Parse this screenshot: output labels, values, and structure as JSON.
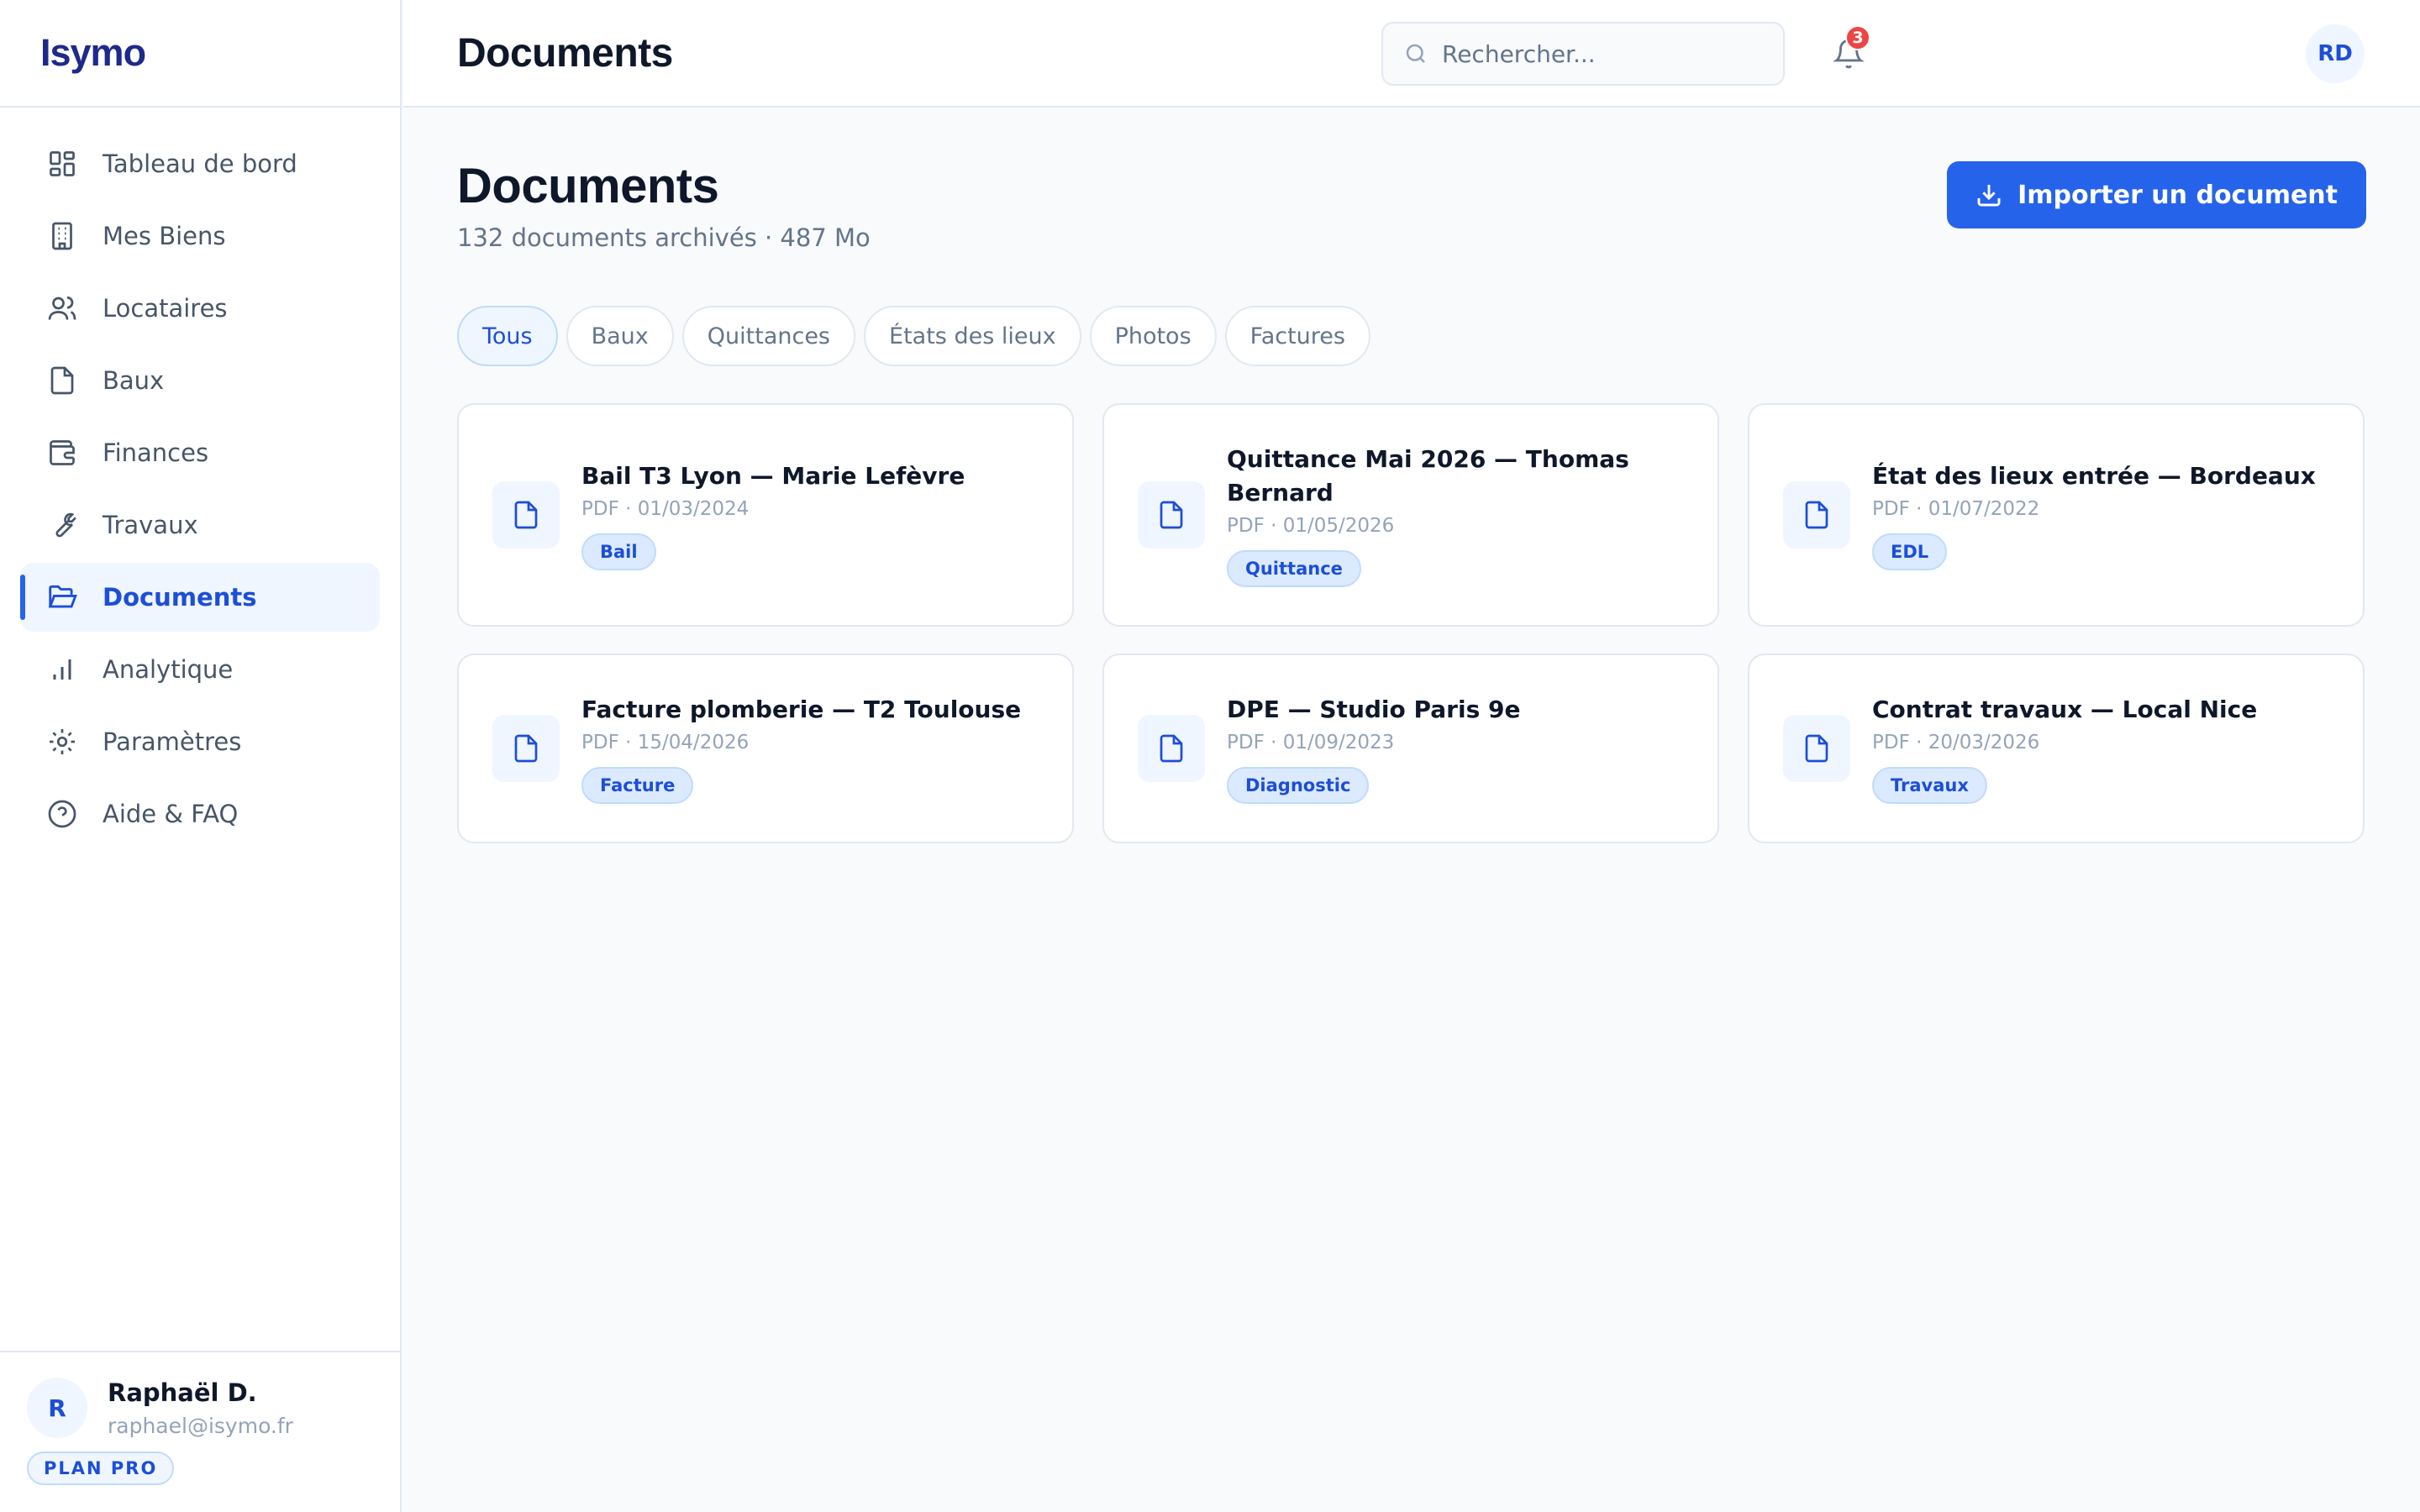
{
  "brand": {
    "name": "Isymo"
  },
  "sidebar": {
    "items": [
      {
        "label": "Tableau de bord",
        "icon": "dashboard-icon"
      },
      {
        "label": "Mes Biens",
        "icon": "building-icon"
      },
      {
        "label": "Locataires",
        "icon": "users-icon"
      },
      {
        "label": "Baux",
        "icon": "file-icon"
      },
      {
        "label": "Finances",
        "icon": "wallet-icon"
      },
      {
        "label": "Travaux",
        "icon": "wrench-icon"
      },
      {
        "label": "Documents",
        "icon": "folder-open-icon",
        "active": true
      },
      {
        "label": "Analytique",
        "icon": "bar-chart-icon"
      },
      {
        "label": "Paramètres",
        "icon": "gear-icon"
      },
      {
        "label": "Aide & FAQ",
        "icon": "help-circle-icon"
      }
    ]
  },
  "user": {
    "initial": "R",
    "name": "Raphaël D.",
    "email": "raphael@isymo.fr",
    "plan": "PLAN PRO"
  },
  "header": {
    "title": "Documents",
    "search_placeholder": "Rechercher...",
    "notifications_count": "3",
    "avatar_initials": "RD"
  },
  "page": {
    "title": "Documents",
    "subtitle": "132 documents archivés · 487 Mo",
    "import_label": "Importer un document"
  },
  "tabs": [
    {
      "label": "Tous",
      "active": true
    },
    {
      "label": "Baux"
    },
    {
      "label": "Quittances"
    },
    {
      "label": "États des lieux"
    },
    {
      "label": "Photos"
    },
    {
      "label": "Factures"
    }
  ],
  "documents": [
    {
      "title": "Bail T3 Lyon — Marie Lefèvre",
      "meta": "PDF · 01/03/2024",
      "tag": "Bail"
    },
    {
      "title": "Quittance Mai 2026 — Thomas Bernard",
      "meta": "PDF · 01/05/2026",
      "tag": "Quittance"
    },
    {
      "title": "État des lieux entrée — Bordeaux",
      "meta": "PDF · 01/07/2022",
      "tag": "EDL"
    },
    {
      "title": "Facture plomberie — T2 Toulouse",
      "meta": "PDF · 15/04/2026",
      "tag": "Facture"
    },
    {
      "title": "DPE — Studio Paris 9e",
      "meta": "PDF · 01/09/2023",
      "tag": "Diagnostic"
    },
    {
      "title": "Contrat travaux — Local Nice",
      "meta": "PDF · 20/03/2026",
      "tag": "Travaux"
    }
  ],
  "colors": {
    "accent": "#2563eb",
    "accent_soft": "#eff6ff",
    "badge_red": "#ef4444",
    "brand": "#1e2a8a"
  }
}
